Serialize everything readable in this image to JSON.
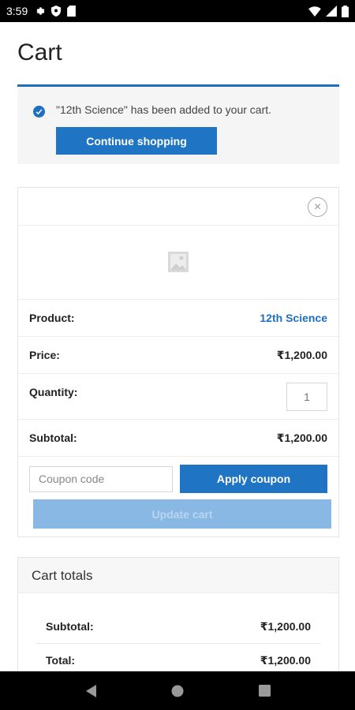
{
  "status_bar": {
    "time": "3:59",
    "left_icons": [
      "gear-icon",
      "shield-icon",
      "sd-card-icon"
    ],
    "right_icons": [
      "wifi-icon",
      "signal-icon",
      "battery-icon"
    ]
  },
  "page": {
    "title": "Cart"
  },
  "notice": {
    "message": "\"12th Science\" has been added to your cart.",
    "continue_label": "Continue shopping",
    "accent_color": "#1e6fc0"
  },
  "cart_item": {
    "product_label": "Product:",
    "product_name": "12th Science",
    "price_label": "Price:",
    "price": "₹1,200.00",
    "quantity_label": "Quantity:",
    "quantity": "1",
    "subtotal_label": "Subtotal:",
    "subtotal": "₹1,200.00"
  },
  "coupon": {
    "placeholder": "Coupon code",
    "apply_label": "Apply coupon",
    "update_label": "Update cart"
  },
  "totals": {
    "title": "Cart totals",
    "subtotal_label": "Subtotal:",
    "subtotal": "₹1,200.00",
    "total_label": "Total:",
    "total": "₹1,200.00"
  },
  "nav_bar": {
    "icons": [
      "back-icon",
      "home-icon",
      "recents-icon"
    ]
  }
}
